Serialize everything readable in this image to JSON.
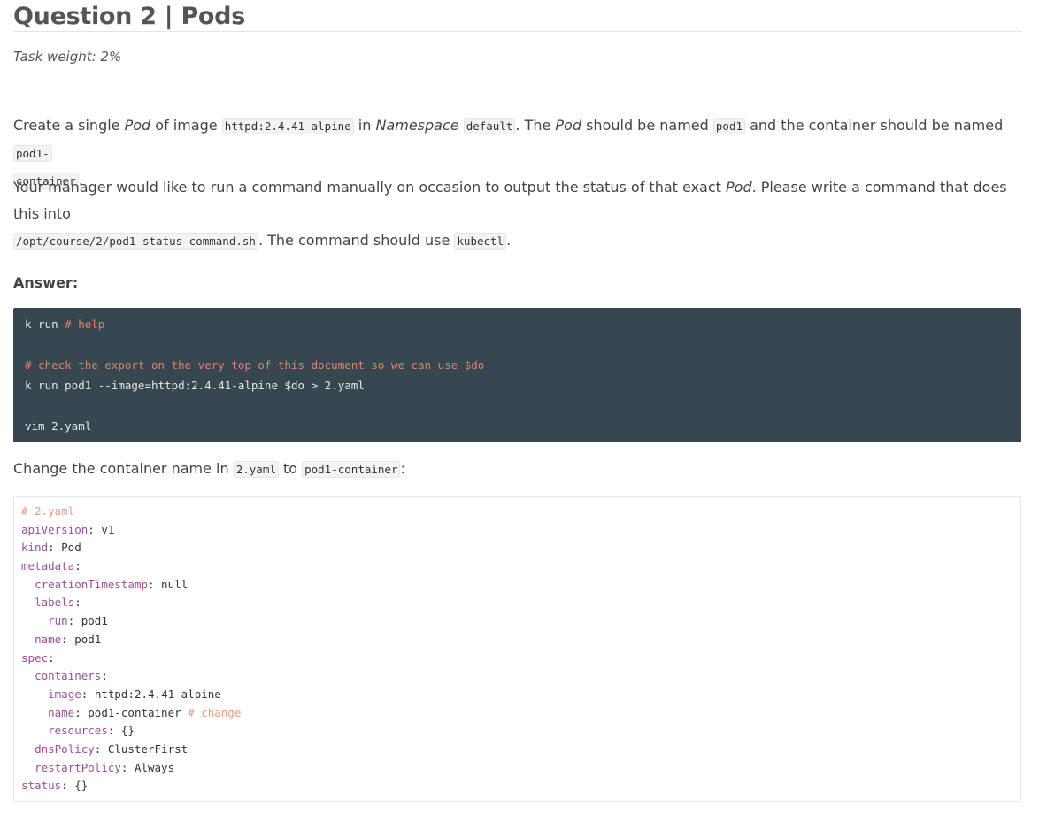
{
  "header": {
    "title": "Question 2 | Pods",
    "weight": "Task weight: 2%"
  },
  "task": {
    "p1": {
      "t1": "Create a single ",
      "e1": "Pod",
      "t2": " of image ",
      "c1": "httpd:2.4.41-alpine",
      "t3": " in ",
      "e2": "Namespace",
      "t4": " ",
      "c2": "default",
      "t5": ". The ",
      "e3": "Pod",
      "t6": " should be named ",
      "c3": "pod1",
      "t7": " and the container should be named ",
      "c4a": "pod1-",
      "c4b": "container",
      "t8": "."
    },
    "p2": {
      "t1": "Your manager would like to run a command manually on occasion to output the status of that exact ",
      "e1": "Pod",
      "t2": ". Please write a command that does this into",
      "c1": "/opt/course/2/pod1-status-command.sh",
      "t3": ". The command should use ",
      "c2": "kubectl",
      "t4": "."
    }
  },
  "answer_label": "Answer:",
  "shell_block": {
    "l1_cmd": "k run ",
    "l1_comment": "# help",
    "l3_comment": "# check the export on the very top of this document so we can use $do",
    "l4": "k run pod1 --image=httpd:2.4.41-alpine $do > 2.yaml",
    "l6": "vim 2.yaml"
  },
  "change_text": {
    "t1": "Change the container name in ",
    "c1": "2.yaml",
    "t2": " to ",
    "c2": "pod1-container",
    "t3": ":"
  },
  "yaml_block": {
    "l1": "# 2.yaml",
    "l2k": "apiVersion",
    "l2v": ": v1",
    "l3k": "kind",
    "l3v": ": Pod",
    "l4k": "metadata",
    "l4v": ":",
    "l5i": "  ",
    "l5k": "creationTimestamp",
    "l5v": ": null",
    "l6i": "  ",
    "l6k": "labels",
    "l6v": ":",
    "l7i": "    ",
    "l7k": "run",
    "l7v": ": pod1",
    "l8i": "  ",
    "l8k": "name",
    "l8v": ": pod1",
    "l9k": "spec",
    "l9v": ":",
    "l10i": "  ",
    "l10k": "containers",
    "l10v": ":",
    "l11i": "  ",
    "l11d": "- ",
    "l11k": "image",
    "l11v": ": httpd:2.4.41-alpine",
    "l12i": "    ",
    "l12k": "name",
    "l12v": ": pod1-container ",
    "l12c": "# change",
    "l13i": "    ",
    "l13k": "resources",
    "l13v": ": {}",
    "l14i": "  ",
    "l14k": "dnsPolicy",
    "l14v": ": ClusterFirst",
    "l15i": "  ",
    "l15k": "restartPolicy",
    "l15v": ": Always",
    "l16k": "status",
    "l16v": ": {}"
  },
  "colors": {
    "dark_block_bg": "#37474f",
    "comment": "#e0806a",
    "yaml_key": "#9b4f96",
    "yaml_comment": "#e89a80"
  }
}
